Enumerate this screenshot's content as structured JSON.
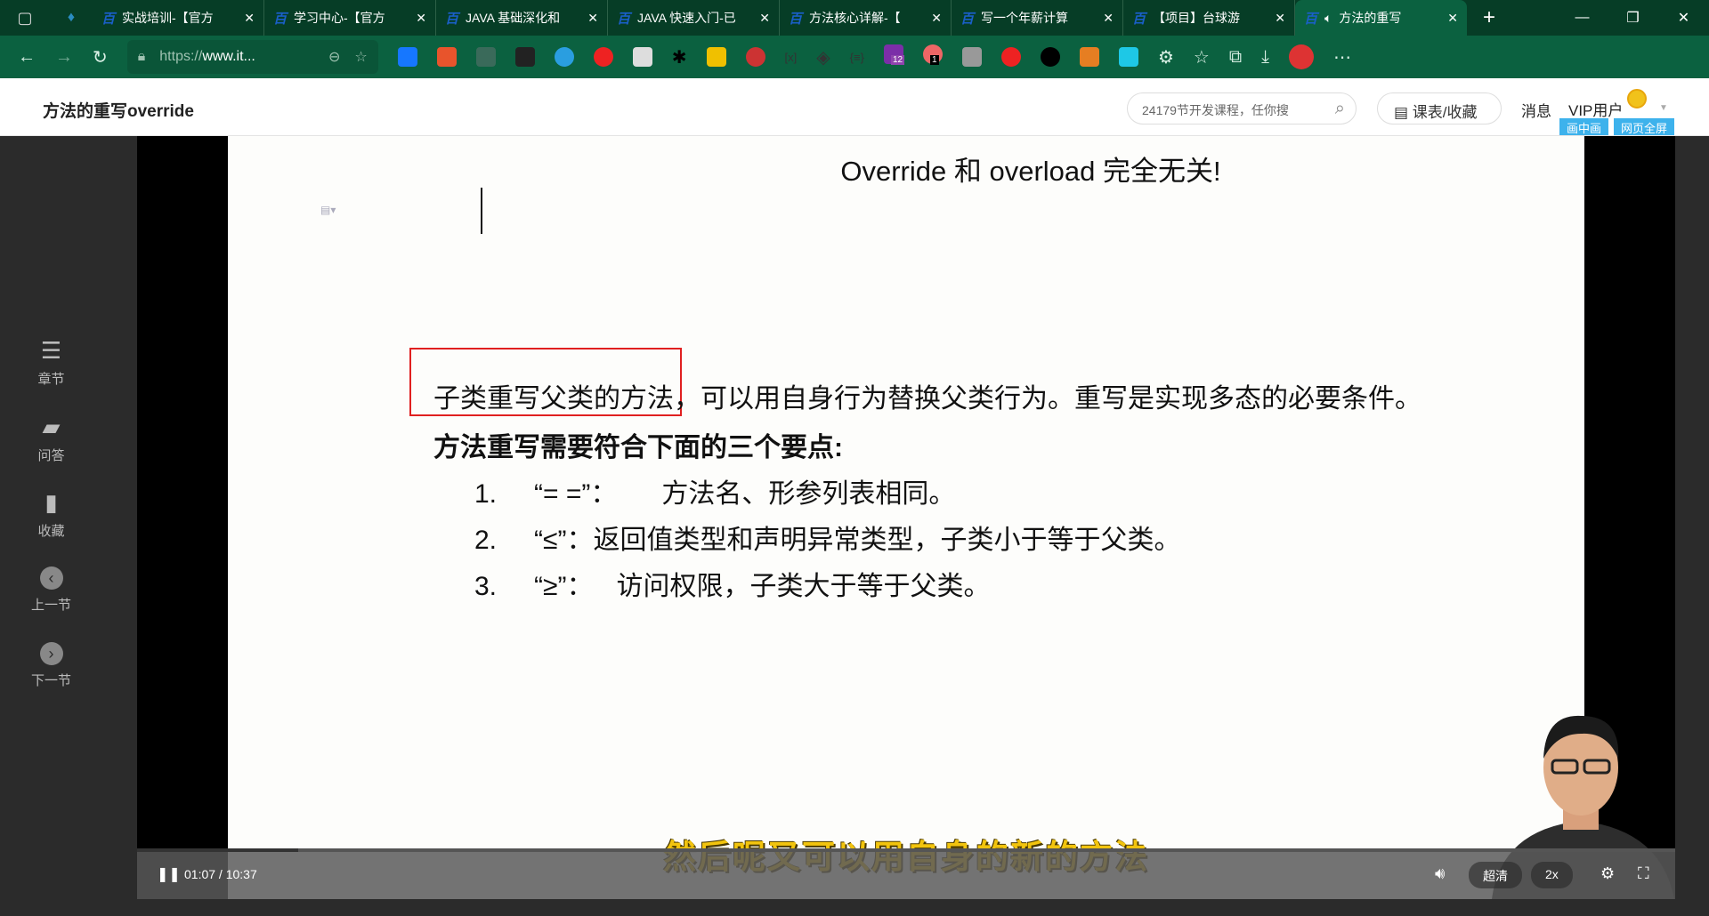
{
  "browser": {
    "tabs": [
      {
        "label": "实战培训-【官方"
      },
      {
        "label": "学习中心-【官方"
      },
      {
        "label": "JAVA 基础深化和"
      },
      {
        "label": "JAVA 快速入门-已"
      },
      {
        "label": "方法核心详解-【"
      },
      {
        "label": "写一个年薪计算"
      },
      {
        "label": "【项目】台球游"
      },
      {
        "label": "方法的重写",
        "active": true
      }
    ],
    "url_prefix": "https://",
    "url_host": "www.it...",
    "badges": {
      "ext12": "12",
      "ext1": "1"
    }
  },
  "header": {
    "title": "方法的重写override",
    "search_placeholder": "24179节开发课程，任你搜",
    "favorites": "课表/收藏",
    "messages": "消息",
    "vip": "VIP用户",
    "pip": "画中画",
    "webfull": "网页全屏"
  },
  "sidebar": {
    "items": [
      {
        "label": "章节",
        "icon": "list-icon"
      },
      {
        "label": "问答",
        "icon": "chat-icon"
      },
      {
        "label": "收藏",
        "icon": "bookmark-icon"
      },
      {
        "label": "上一节",
        "icon": "chevron-left-icon"
      },
      {
        "label": "下一节",
        "icon": "chevron-right-icon"
      }
    ]
  },
  "slide": {
    "title": "Override 和 overload 完全无关!",
    "line1_boxed": "子类重写父类的方法",
    "line1_rest": "，可以用自身行为替换父类行为。重写是实现多态的必要条件。",
    "heading": "方法重写需要符合下面的三个要点:",
    "points": [
      {
        "num": "1.",
        "sym": "“= =”：",
        "text": "方法名、形参列表相同。"
      },
      {
        "num": "2.",
        "sym": "“≤”：",
        "text": "返回值类型和声明异常类型，子类小于等于父类。"
      },
      {
        "num": "3.",
        "sym": "“≥”：",
        "text": "访问权限，子类大于等于父类。"
      }
    ]
  },
  "player": {
    "subtitle": "然后呢又可以用自身的新的方法",
    "time": "01:07 / 10:37",
    "progress": 0.105,
    "quality": "超清",
    "speed": "2x"
  }
}
